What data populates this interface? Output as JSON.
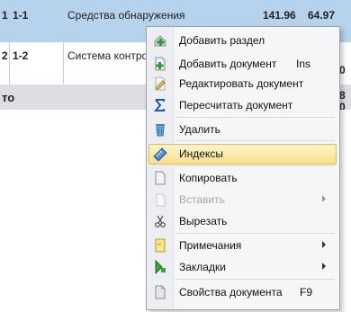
{
  "table": {
    "rows": [
      {
        "num": "1",
        "code": "1-1",
        "name": "Средства обнаружения",
        "val1": "141.96",
        "val2": "64.97"
      },
      {
        "num": "2",
        "code": "1-2",
        "name": "Система контроля",
        "val1": "",
        "val2": ""
      }
    ],
    "total_label": "то",
    "right_fragments": [
      "0",
      "8",
      "0"
    ]
  },
  "menu": {
    "items": [
      {
        "label": "Добавить раздел",
        "shortcut": "",
        "icon": "add-section-icon",
        "disabled": false,
        "submenu": false
      },
      {
        "label": "Добавить документ",
        "shortcut": "Ins",
        "icon": "add-document-icon",
        "disabled": false,
        "submenu": false
      },
      {
        "label": "Редактировать документ",
        "shortcut": "",
        "icon": "edit-document-icon",
        "disabled": false,
        "submenu": false
      },
      {
        "label": "Пересчитать документ",
        "shortcut": "",
        "icon": "sigma-icon",
        "disabled": false,
        "submenu": false
      },
      {
        "label": "Удалить",
        "shortcut": "",
        "icon": "trash-icon",
        "disabled": false,
        "submenu": false
      },
      {
        "label": "Индексы",
        "shortcut": "",
        "icon": "ruler-icon",
        "disabled": false,
        "submenu": false,
        "highlighted": true
      },
      {
        "label": "Копировать",
        "shortcut": "",
        "icon": "copy-icon",
        "disabled": false,
        "submenu": false
      },
      {
        "label": "Вставить",
        "shortcut": "",
        "icon": "paste-icon",
        "disabled": true,
        "submenu": true
      },
      {
        "label": "Вырезать",
        "shortcut": "",
        "icon": "scissors-icon",
        "disabled": false,
        "submenu": false
      },
      {
        "label": "Примечания",
        "shortcut": "",
        "icon": "note-icon",
        "disabled": false,
        "submenu": true
      },
      {
        "label": "Закладки",
        "shortcut": "",
        "icon": "bookmark-icon",
        "disabled": false,
        "submenu": true
      },
      {
        "label": "Свойства документа",
        "shortcut": "F9",
        "icon": "properties-icon",
        "disabled": false,
        "submenu": false
      }
    ]
  }
}
